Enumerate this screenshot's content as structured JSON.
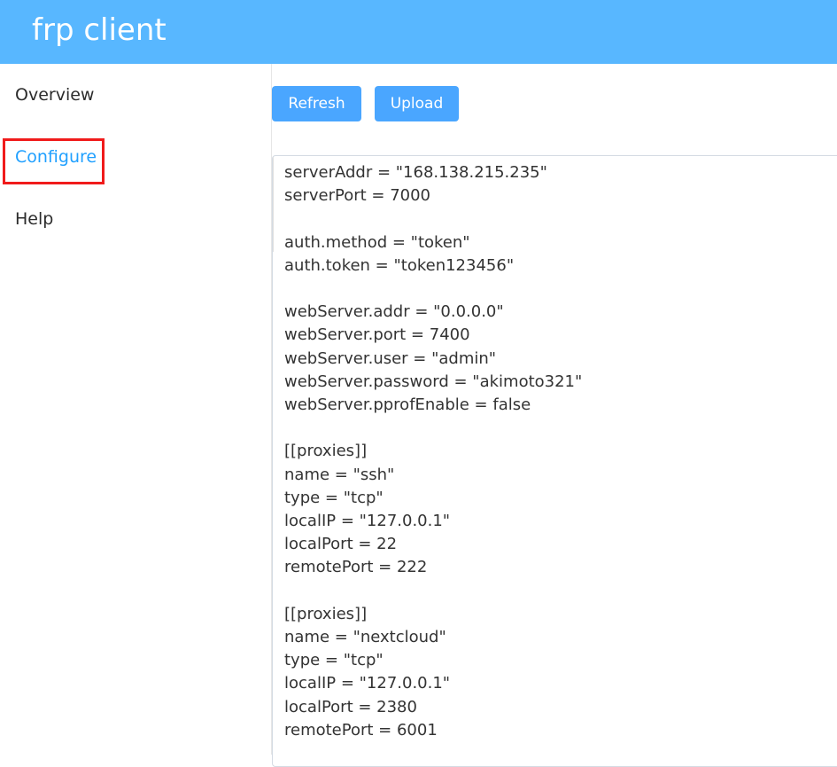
{
  "header": {
    "title": "frp client"
  },
  "sidebar": {
    "items": [
      {
        "label": "Overview"
      },
      {
        "label": "Configure"
      },
      {
        "label": "Help"
      }
    ],
    "active_index": 1
  },
  "toolbar": {
    "refresh_label": "Refresh",
    "upload_label": "Upload"
  },
  "config": {
    "text": "serverAddr = \"168.138.215.235\"\nserverPort = 7000\n\nauth.method = \"token\"\nauth.token = \"token123456\"\n\nwebServer.addr = \"0.0.0.0\"\nwebServer.port = 7400\nwebServer.user = \"admin\"\nwebServer.password = \"akimoto321\"\nwebServer.pprofEnable = false\n\n[[proxies]]\nname = \"ssh\"\ntype = \"tcp\"\nlocalIP = \"127.0.0.1\"\nlocalPort = 22\nremotePort = 222\n\n[[proxies]]\nname = \"nextcloud\"\ntype = \"tcp\"\nlocalIP = \"127.0.0.1\"\nlocalPort = 2380\nremotePort = 6001"
  },
  "colors": {
    "header_bg": "#58b7ff",
    "button_bg": "#4aa6ff",
    "active_nav": "#20a0ff",
    "highlight_border": "#f01b1b"
  }
}
